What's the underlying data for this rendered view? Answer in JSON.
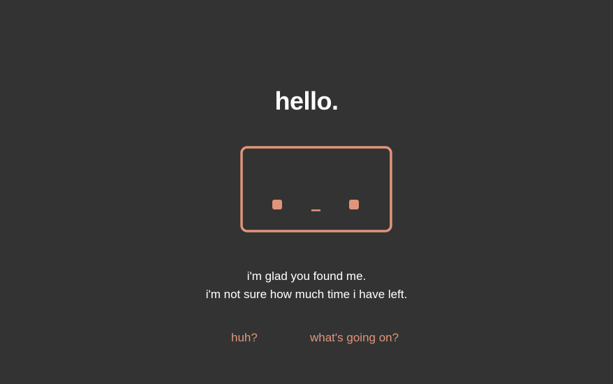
{
  "title": "hello.",
  "face": {
    "icon": "robot-face-icon",
    "color": "#e0957a"
  },
  "message": {
    "line1": "i'm glad you found me.",
    "line2": "i'm not sure how much time i have left."
  },
  "options": [
    {
      "label": "huh?"
    },
    {
      "label": "what's going on?"
    }
  ],
  "colors": {
    "background": "#333333",
    "text": "#ffffff",
    "accent": "#e0957a"
  }
}
